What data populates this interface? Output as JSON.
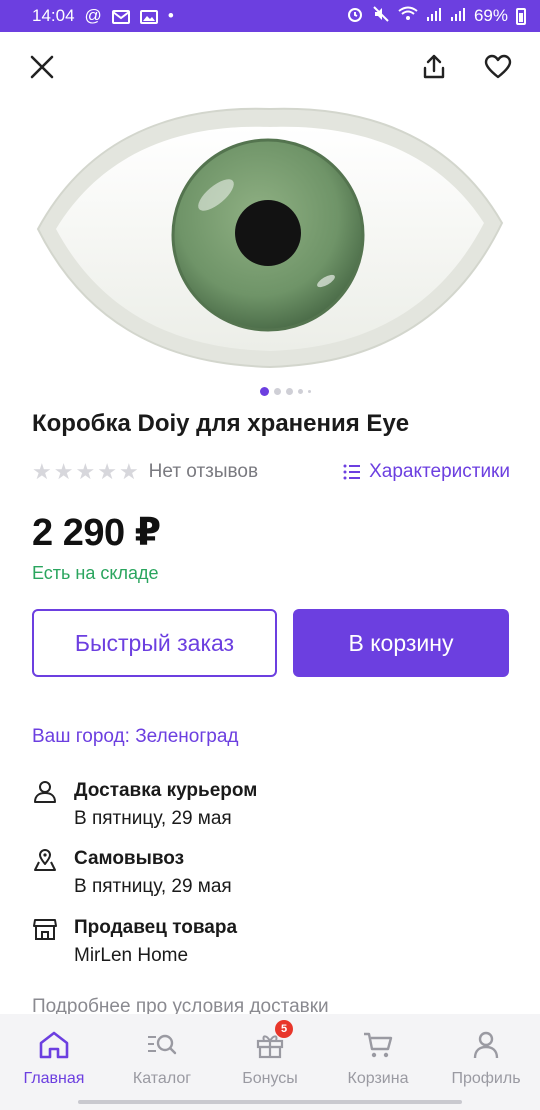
{
  "status_bar": {
    "time": "14:04",
    "battery_percent": "69%"
  },
  "product": {
    "title": "Коробка Doiy для хранения Eye",
    "rating_stars": 0,
    "reviews_text": "Нет отзывов",
    "specs_link": "Характеристики",
    "price": "2 290 ₽",
    "stock": "Есть на складе",
    "gallery_index": 1,
    "gallery_count": 5
  },
  "actions": {
    "quick_order": "Быстрый заказ",
    "add_to_cart": "В корзину"
  },
  "delivery": {
    "city_label": "Ваш город: Зеленоград",
    "items": [
      {
        "title": "Доставка курьером",
        "subtitle": "В пятницу, 29 мая",
        "icon": "person-icon"
      },
      {
        "title": "Самовывоз",
        "subtitle": "В пятницу, 29 мая",
        "icon": "map-pin-icon"
      },
      {
        "title": "Продавец товара",
        "subtitle": "MirLen Home",
        "icon": "store-icon"
      }
    ],
    "more_link": "Подробнее про условия доставки"
  },
  "bottom_nav": {
    "items": [
      {
        "label": "Главная",
        "icon": "home-icon",
        "active": true
      },
      {
        "label": "Каталог",
        "icon": "catalog-search-icon",
        "active": false
      },
      {
        "label": "Бонусы",
        "icon": "gift-icon",
        "active": false,
        "badge": "5"
      },
      {
        "label": "Корзина",
        "icon": "cart-icon",
        "active": false
      },
      {
        "label": "Профиль",
        "icon": "profile-icon",
        "active": false
      }
    ]
  },
  "colors": {
    "accent": "#6c3fe0",
    "in_stock": "#2aa55e",
    "badge": "#e8362b",
    "iris": "#6f9468"
  }
}
